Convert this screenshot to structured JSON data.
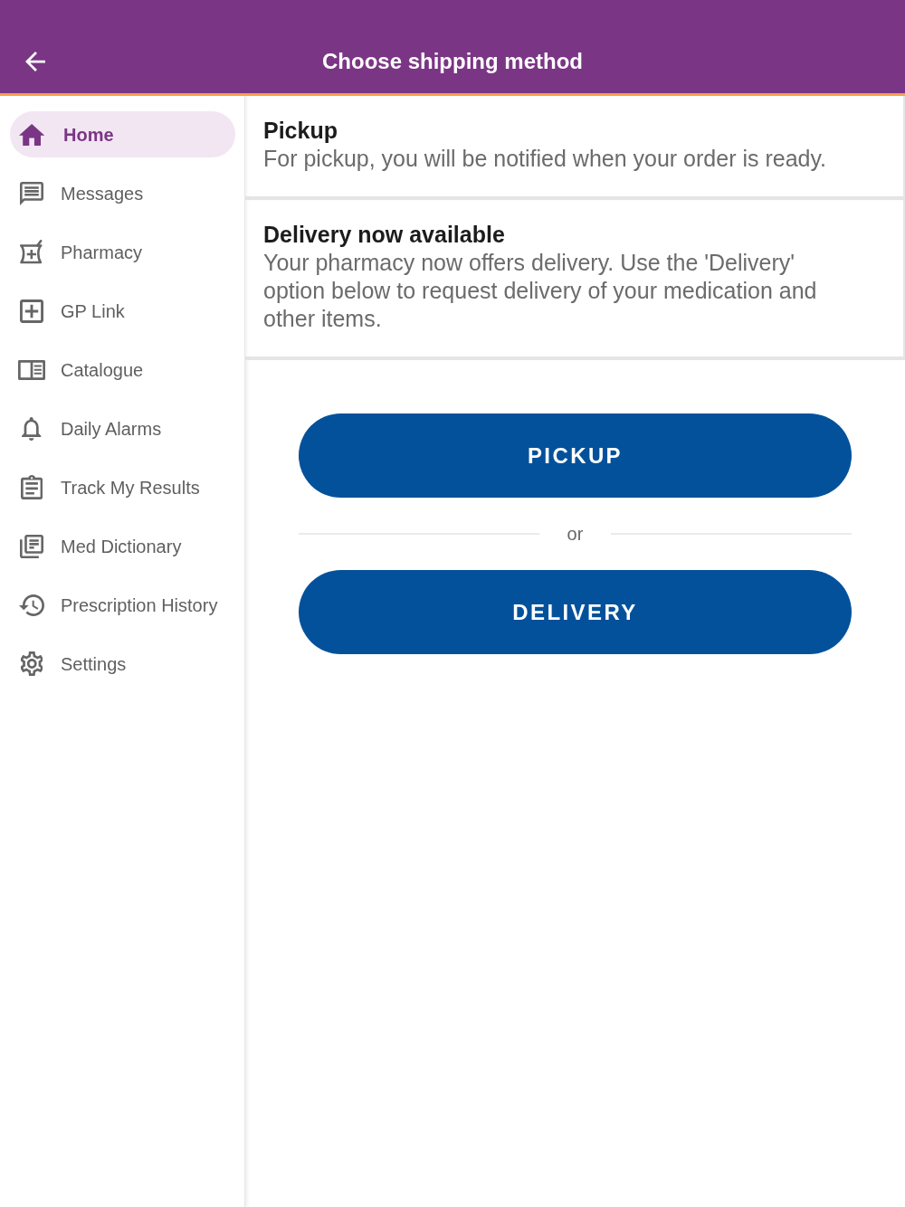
{
  "app_bar": {
    "title": "Choose shipping method"
  },
  "sidebar": {
    "items": [
      {
        "label": "Home",
        "selected": true
      },
      {
        "label": "Messages",
        "selected": false
      },
      {
        "label": "Pharmacy",
        "selected": false
      },
      {
        "label": "GP Link",
        "selected": false
      },
      {
        "label": "Catalogue",
        "selected": false
      },
      {
        "label": "Daily Alarms",
        "selected": false
      },
      {
        "label": "Track My Results",
        "selected": false
      },
      {
        "label": "Med Dictionary",
        "selected": false
      },
      {
        "label": "Prescription History",
        "selected": false
      },
      {
        "label": "Settings",
        "selected": false
      }
    ]
  },
  "notices": [
    {
      "title": "Pickup",
      "body": "For pickup, you will be notified when your order is ready."
    },
    {
      "title": "Delivery now available",
      "body": "Your pharmacy now offers delivery. Use the 'Delivery' option below to request delivery of your medication and other items."
    }
  ],
  "actions": {
    "buttons": [
      {
        "label": "PICKUP"
      },
      {
        "label": "DELIVERY"
      }
    ],
    "separator": "or"
  }
}
